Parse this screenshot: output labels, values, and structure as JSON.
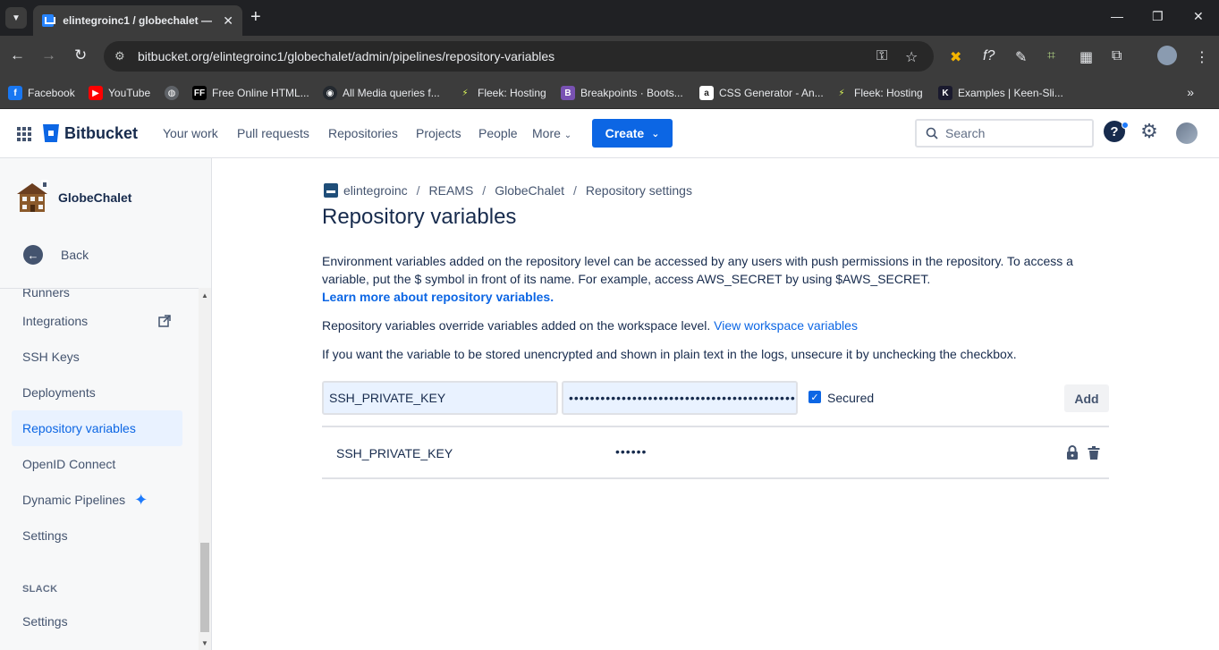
{
  "browser": {
    "tab_title": "elintegroinc1 / globechalet — Bitbucket",
    "url": "bitbucket.org/elintegroinc1/globechalet/admin/pipelines/repository-variables",
    "bookmarks": [
      {
        "label": "Facebook",
        "color": "#1877f2",
        "glyph": "f"
      },
      {
        "label": "YouTube",
        "color": "#ff0000",
        "glyph": "▶"
      },
      {
        "label": "",
        "color": "#5f6368",
        "glyph": "◍"
      },
      {
        "label": "Free Online HTML...",
        "color": "#000000",
        "glyph": "FF"
      },
      {
        "label": "All Media queries f...",
        "color": "#24292f",
        "glyph": "◉"
      },
      {
        "label": "Fleek: Hosting",
        "color": "#3c3c3c",
        "glyph": "⚡"
      },
      {
        "label": "Breakpoints · Boots...",
        "color": "#7952b3",
        "glyph": "B"
      },
      {
        "label": "CSS Generator - An...",
        "color": "#222222",
        "glyph": "a"
      },
      {
        "label": "Fleek: Hosting",
        "color": "#3c3c3c",
        "glyph": "⚡"
      },
      {
        "label": "Examples | Keen-Sli...",
        "color": "#1a1a2e",
        "glyph": "K"
      }
    ]
  },
  "header": {
    "product": "Bitbucket",
    "nav": [
      "Your work",
      "Pull requests",
      "Repositories",
      "Projects",
      "People",
      "More"
    ],
    "create_label": "Create",
    "search_placeholder": "Search"
  },
  "sidebar": {
    "repo_name": "GlobeChalet",
    "back_label": "Back",
    "partial_item": "Runners",
    "items": [
      {
        "label": "Integrations"
      },
      {
        "label": "SSH Keys"
      },
      {
        "label": "Deployments"
      },
      {
        "label": "Repository variables"
      },
      {
        "label": "OpenID Connect"
      },
      {
        "label": "Dynamic Pipelines"
      },
      {
        "label": "Settings"
      }
    ],
    "section_slack": "SLACK",
    "slack_settings": "Settings"
  },
  "main": {
    "breadcrumb": [
      "elintegroinc",
      "REAMS",
      "GlobeChalet",
      "Repository settings"
    ],
    "title": "Repository variables",
    "desc_1": "Environment variables added on the repository level can be accessed by any users with push permissions in the repository. To access a variable, put the $ symbol in front of its name. For example, access AWS_SECRET by using $AWS_SECRET.",
    "learn_more": "Learn more about repository variables.",
    "desc_2": "Repository variables override variables added on the workspace level.",
    "workspace_link": "View workspace variables",
    "desc_3": "If you want the variable to be stored unencrypted and shown in plain text in the logs, unsecure it by unchecking the checkbox.",
    "form": {
      "name_value": "SSH_PRIVATE_KEY",
      "value_masked": "••••••••••••••••••••••••••••••••••••••••••••",
      "secured_label": "Secured",
      "add_label": "Add"
    },
    "variables": [
      {
        "name": "SSH_PRIVATE_KEY",
        "value": "••••••"
      }
    ]
  }
}
